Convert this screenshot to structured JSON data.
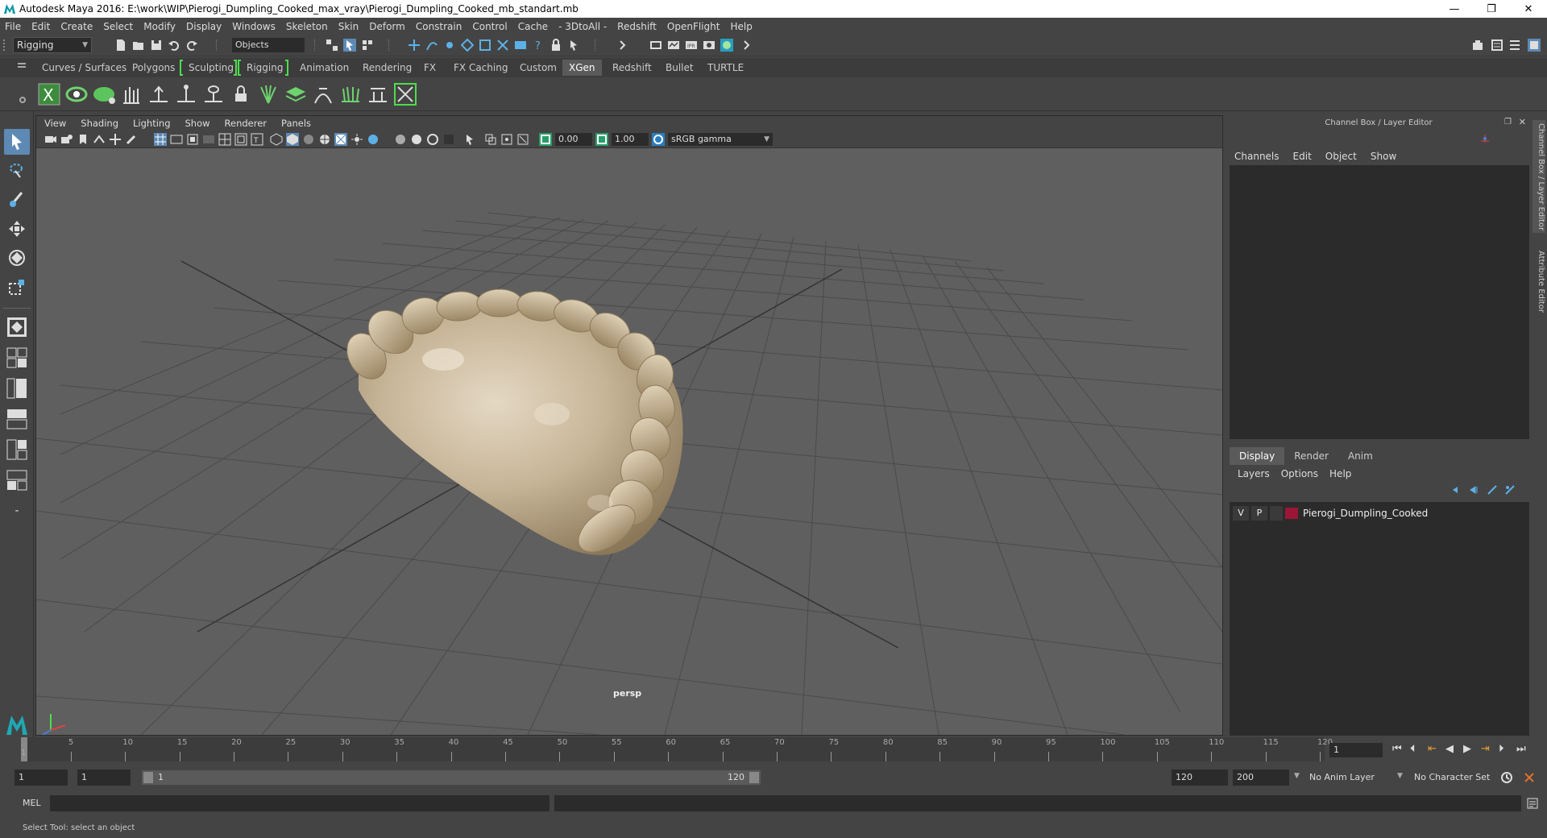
{
  "window": {
    "title": "Autodesk Maya 2016: E:\\work\\WIP\\Pierogi_Dumpling_Cooked_max_vray\\Pierogi_Dumpling_Cooked_mb_standart.mb",
    "minimize": "—",
    "restore": "❐",
    "close": "✕"
  },
  "menubar": [
    "File",
    "Edit",
    "Create",
    "Select",
    "Modify",
    "Display",
    "Windows",
    "Skeleton",
    "Skin",
    "Deform",
    "Constrain",
    "Control",
    "Cache",
    "- 3DtoAll -",
    "Redshift",
    "OpenFlight",
    "Help"
  ],
  "statusline": {
    "mode": "Rigging",
    "selection_mask": "Objects"
  },
  "shelf_tabs": [
    "Curves / Surfaces",
    "Polygons",
    "Sculpting",
    "Rigging",
    "Animation",
    "Rendering",
    "FX",
    "FX Caching",
    "Custom",
    "XGen",
    "Redshift",
    "Bullet",
    "TURTLE"
  ],
  "shelf_active_tab": "XGen",
  "viewport": {
    "menu": [
      "View",
      "Shading",
      "Lighting",
      "Show",
      "Renderer",
      "Panels"
    ],
    "exposure": "0.00",
    "gamma": "1.00",
    "color_space": "sRGB gamma",
    "camera": "persp"
  },
  "right_panel": {
    "title": "Channel Box / Layer Editor",
    "menu": [
      "Channels",
      "Edit",
      "Object",
      "Show"
    ],
    "tabs": [
      "Display",
      "Render",
      "Anim"
    ],
    "active_tab": "Display",
    "submenu": [
      "Layers",
      "Options",
      "Help"
    ],
    "layers": [
      {
        "visible": "V",
        "playback": "P",
        "color": "#9c1537",
        "name": "Pierogi_Dumpling_Cooked"
      }
    ]
  },
  "side_tabs": [
    "Channel Box / Layer Editor",
    "Attribute Editor"
  ],
  "timeslider": {
    "ticks": [
      "5",
      "10",
      "15",
      "20",
      "25",
      "30",
      "35",
      "40",
      "45",
      "50",
      "55",
      "60",
      "65",
      "70",
      "75",
      "80",
      "85",
      "90",
      "95",
      "100",
      "105",
      "110",
      "115",
      "120"
    ],
    "start_label": "1",
    "current_frame": "1"
  },
  "range": {
    "start": "1",
    "playback_start": "1",
    "bar_start": "1",
    "bar_end": "120",
    "playback_end": "120",
    "end": "200",
    "anim_layer": "No Anim Layer",
    "character_set": "No Character Set"
  },
  "cmdline": {
    "label": "MEL"
  },
  "helpline": {
    "text": "Select Tool: select an object"
  }
}
